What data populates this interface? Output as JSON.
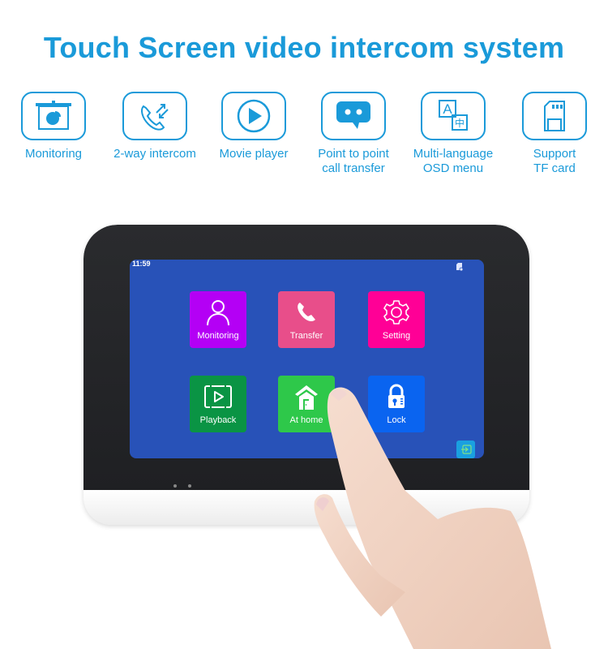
{
  "title": "Touch Screen video intercom system",
  "features": [
    {
      "icon": "monitor-chart-icon",
      "label": "Monitoring"
    },
    {
      "icon": "phone-transfer-icon",
      "label": "2-way intercom"
    },
    {
      "icon": "play-circle-icon",
      "label": "Movie player"
    },
    {
      "icon": "chat-bubble-icon",
      "label": "Point to point\ncall transfer"
    },
    {
      "icon": "language-icon",
      "label": "Multi-language\nOSD menu"
    },
    {
      "icon": "sd-card-icon",
      "label": "Support\nTF card"
    }
  ],
  "colors": {
    "accent": "#1a9ad9",
    "screen_bg": "#2852b8",
    "monitoring": "#b400f5",
    "transfer": "#e84e8a",
    "setting": "#ff0096",
    "playback": "#0a9444",
    "at_home": "#2ec84a",
    "lock": "#0a64f0"
  },
  "screen": {
    "clock": "11:59",
    "tiles": [
      {
        "label": "Monitoring",
        "icon": "person-icon"
      },
      {
        "label": "Transfer",
        "icon": "phone-icon"
      },
      {
        "label": "Setting",
        "icon": "gear-icon"
      },
      {
        "label": "Playback",
        "icon": "playback-icon"
      },
      {
        "label": "At home",
        "icon": "home-icon"
      },
      {
        "label": "Lock",
        "icon": "lock-icon"
      }
    ]
  }
}
